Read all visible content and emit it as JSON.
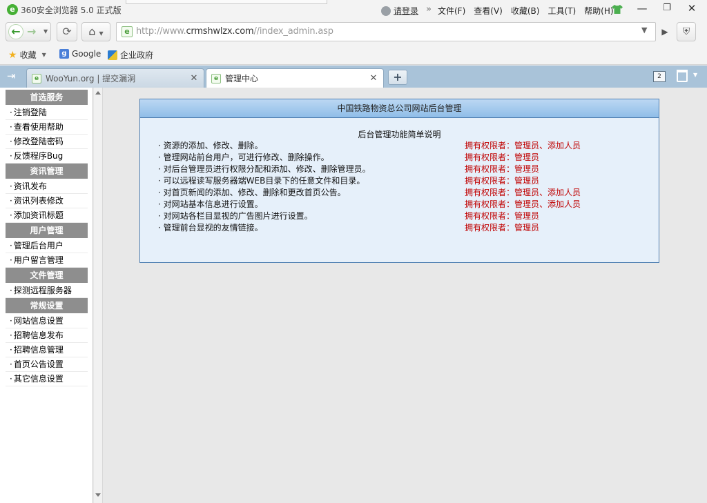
{
  "browser": {
    "title": "360安全浏览器 5.0 正式版",
    "login": "请登录",
    "menu": [
      "文件(F)",
      "查看(V)",
      "收藏(B)",
      "工具(T)",
      "帮助(H)"
    ],
    "url_prefix": "http://www.",
    "url_domain": "crmshwlzx.com",
    "url_path": "//index_admin.asp",
    "favorites": {
      "label": "收藏",
      "items": [
        "Google",
        "企业政府"
      ]
    },
    "tabs": [
      {
        "title": "WooYun.org | 提交漏洞",
        "active": false
      },
      {
        "title": "管理中心",
        "active": true
      }
    ],
    "tab_count": "2"
  },
  "sidebar": {
    "groups": [
      {
        "header": "首选服务",
        "items": [
          "注销登陆",
          "查看使用帮助",
          "修改登陆密码",
          "反馈程序Bug"
        ]
      },
      {
        "header": "资讯管理",
        "items": [
          "资讯发布",
          "资讯列表修改",
          "添加资讯标题"
        ]
      },
      {
        "header": "用户管理",
        "items": [
          "管理后台用户",
          "用户留言管理"
        ]
      },
      {
        "header": "文件管理",
        "items": [
          "探测远程服务器"
        ]
      },
      {
        "header": "常规设置",
        "items": [
          "网站信息设置",
          "招聘信息发布",
          "招聘信息管理",
          "首页公告设置",
          "其它信息设置"
        ]
      }
    ]
  },
  "main": {
    "panel_title": "中国铁路物资总公司网站后台管理",
    "subtitle": "后台管理功能简单说明",
    "features": [
      {
        "desc": "资源的添加、修改、删除。",
        "perm": "拥有权限者：管理员、添加人员"
      },
      {
        "desc": "管理网站前台用户，可进行修改、删除操作。",
        "perm": "拥有权限者：管理员"
      },
      {
        "desc": "对后台管理员进行权限分配和添加、修改、删除管理员。",
        "perm": "拥有权限者：管理员"
      },
      {
        "desc": "可以远程读写服务器端WEB目录下的任意文件和目录。",
        "perm": "拥有权限者：管理员"
      },
      {
        "desc": "对首页新闻的添加、修改、删除和更改首页公告。",
        "perm": "拥有权限者：管理员、添加人员"
      },
      {
        "desc": "对网站基本信息进行设置。",
        "perm": "拥有权限者：管理员、添加人员"
      },
      {
        "desc": "对网站各栏目显视的广告图片进行设置。",
        "perm": "拥有权限者：管理员"
      },
      {
        "desc": "管理前台显视的友情链接。",
        "perm": "拥有权限者：管理员"
      }
    ]
  },
  "colors": {
    "accent_green": "#3a9b2f",
    "panel_border": "#4f7fb2",
    "perm_red": "#c00000",
    "nav_header_gray": "#8e8e8e"
  }
}
